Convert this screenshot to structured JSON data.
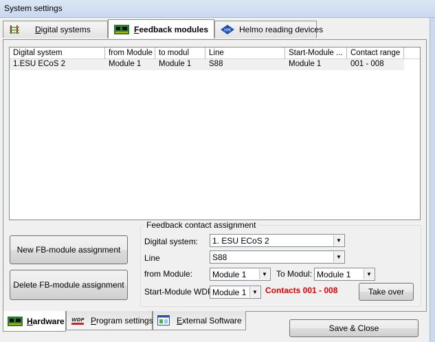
{
  "window": {
    "title": "System settings"
  },
  "top_tabs": [
    {
      "label_ul": "D",
      "label_rest": "igital systems",
      "icon": "track-icon"
    },
    {
      "label_ul": "F",
      "label_rest": "eedback modules",
      "icon": "circuit-board-icon"
    },
    {
      "label": "Helmo reading devices",
      "icon": "helmo-icon"
    }
  ],
  "list": {
    "columns": [
      "Digital system",
      "from Module",
      "to modul",
      "Line",
      "Start-Module ...",
      "Contact range"
    ],
    "rows": [
      [
        "1.ESU ECoS 2",
        "Module 1",
        "Module 1",
        "S88",
        "Module 1",
        "001 - 008"
      ]
    ]
  },
  "buttons": {
    "new_assignment": "New FB-module assignment",
    "delete_assignment": "Delete FB-module assignment",
    "take_over": "Take over",
    "save_close": "Save & Close"
  },
  "assignment": {
    "title": "Feedback contact assignment",
    "digital_system_label": "Digital system:",
    "digital_system_value": "1. ESU ECoS 2",
    "line_label": "Line",
    "line_value": "S88",
    "from_module_label": "from Module:",
    "from_module_value": "Module 1",
    "to_modul_label": "To Modul:",
    "to_modul_value": "Module 1",
    "start_module_label": "Start-Module WDP:",
    "start_module_value": "Module 1",
    "contacts_text": "Contacts 001 - 008"
  },
  "bottom_tabs": [
    {
      "label_ul": "H",
      "label_rest": "ardware",
      "icon": "circuit-board-icon"
    },
    {
      "label_ul": "P",
      "label_rest": "rogram settings",
      "icon": "wdp-icon"
    },
    {
      "label_ul": "E",
      "label_rest": "xternal Software",
      "icon": "window-icon"
    }
  ]
}
